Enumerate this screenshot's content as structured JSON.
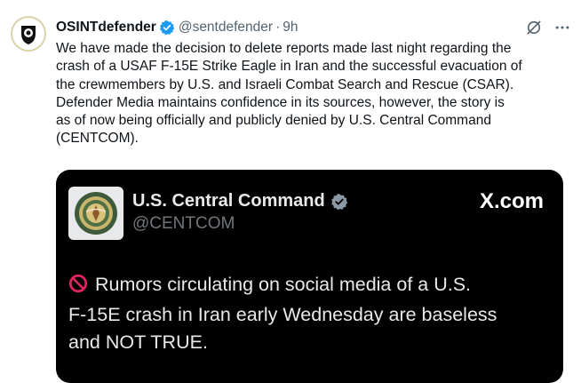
{
  "colors": {
    "verified_blue": "#1d9bf0",
    "secondary_text": "#536471",
    "embed_background": "#000000",
    "embed_text": "#e7e9ea",
    "no_entry_red": "#e0245e"
  },
  "tweet": {
    "author_name": "OSINTdefender",
    "handle": "@sentdefender",
    "separator": "·",
    "time": "9h",
    "icons": [
      "verified-badge-icon",
      "grok-icon",
      "more-icon"
    ],
    "body_lines": [
      "We have made the decision to delete reports made last night regarding the",
      "crash of a USAF F-15E Strike Eagle in Iran and the successful evacuation of",
      "the crewmembers by U.S. and Israeli Combat Search and Rescue (CSAR).",
      "Defender Media maintains confidence in its sources, however, the story is",
      "as of now being officially and publicly denied by U.S. Central Command",
      "(CENTCOM)."
    ]
  },
  "embed": {
    "author_name": "U.S. Central Command",
    "handle": "@CENTCOM",
    "source": "X.com",
    "icons": [
      "centcom-seal-icon",
      "verified-badge-icon",
      "no-entry-icon"
    ],
    "text_lines": [
      "Rumors circulating on social media of a U.S.",
      "F-15E crash in Iran early Wednesday are baseless",
      "and NOT TRUE."
    ]
  }
}
